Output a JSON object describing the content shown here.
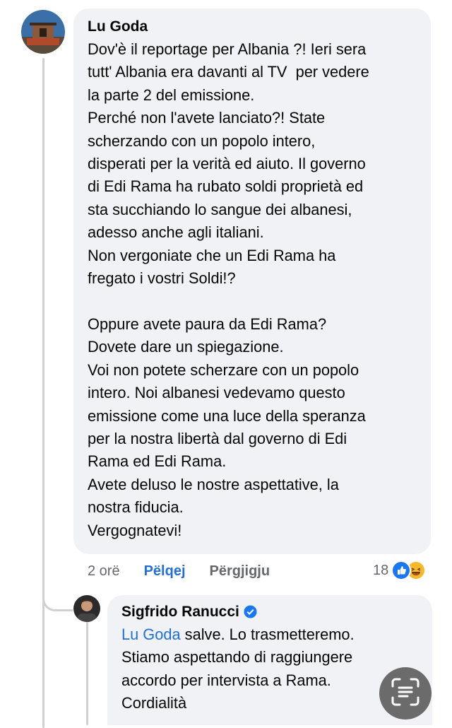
{
  "comment": {
    "author": "Lu Goda",
    "text": "Dov'è il reportage per Albania ?! Ieri sera\ntutt' Albania era davanti al TV  per vedere\nla parte 2 del emissione.\nPerché non l'avete lanciato?! State\nscherzando con un popolo intero,\ndisperati per la verità ed aiuto. Il governo\ndi Edi Rama ha rubato soldi proprietà ed\nsta succhiando lo sangue dei albanesi,\nadesso anche agli italiani.\nNon vergoniate che un Edi Rama ha\nfregato i vostri Soldi!?\n\nOppure avete paura da Edi Rama?\nDovete dare un spiegazione.\nVoi non potete scherzare con un popolo\nintero. Noi albanesi vedevamo questo\nemissione come una luce della speranza\nper la nostra libertà dal governo di Edi\nRama ed Edi Rama.\nAvete deluso le nostre aspettative, la\nnostra fiducia.\nVergognatevi!",
    "time": "2 orë",
    "like_label": "Pëlqej",
    "reply_label": "Përgjigju",
    "reaction_count": "18",
    "reaction_icons": [
      "like-icon",
      "haha-icon"
    ]
  },
  "reply": {
    "author": "Sigfrido Ranucci",
    "verified": true,
    "mention": "Lu Goda",
    "text": " salve. Lo trasmetteremo.\nStiamo aspettando di raggiungere\naccordo per intervista a Rama.\nCordialità"
  },
  "colors": {
    "bubble": "#f0f2f5",
    "accent": "#216fdb",
    "muted": "#65676b"
  }
}
